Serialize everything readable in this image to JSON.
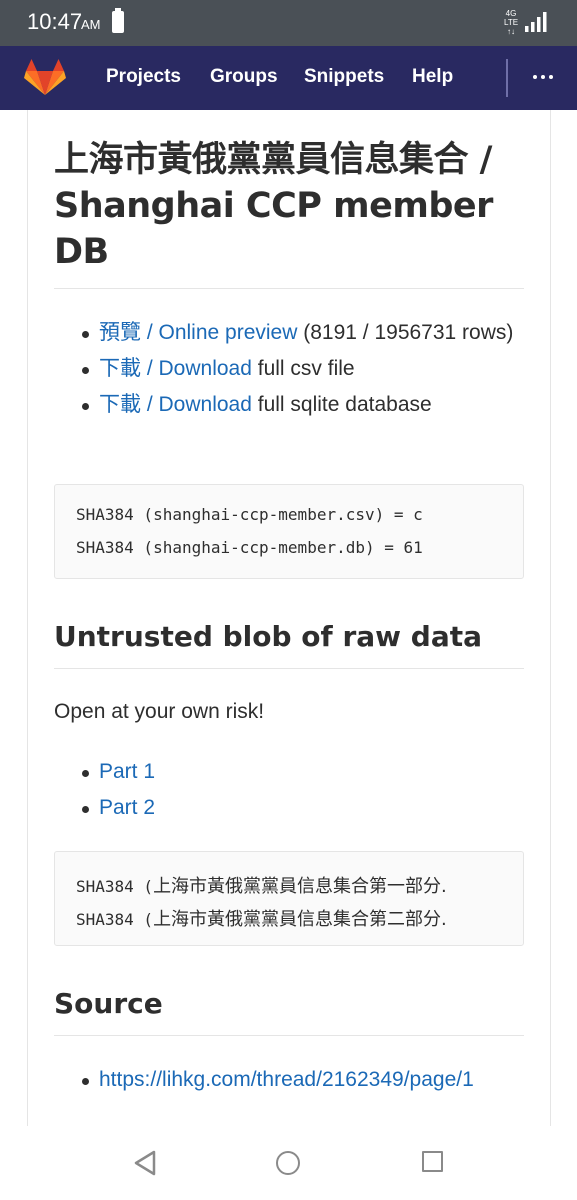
{
  "status_bar": {
    "time": "10:47",
    "ampm": "AM",
    "network": "4G LTE",
    "icons": [
      "battery-icon",
      "signal-icon"
    ]
  },
  "header": {
    "logo": "gitlab-logo",
    "nav": [
      "Projects",
      "Groups",
      "Snippets",
      "Help"
    ],
    "more_icon": "more-dots-icon"
  },
  "page": {
    "title": "上海市黃俄黨黨員信息集合 / Shanghai CCP member DB",
    "downloads": [
      {
        "link": "預覽 / Online preview",
        "suffix": " (8191 / 1956731 rows)"
      },
      {
        "link": "下載 / Download",
        "suffix": " full csv file"
      },
      {
        "link": "下載 / Download",
        "suffix": " full sqlite database"
      }
    ],
    "hashes_1": [
      "SHA384 (shanghai-ccp-member.csv) = c",
      "SHA384 (shanghai-ccp-member.db) = 61"
    ],
    "section_raw": {
      "heading": "Untrusted blob of raw data",
      "warning": "Open at your own risk!",
      "parts": [
        "Part 1",
        "Part 2"
      ],
      "hash_prefix": "SHA384 (",
      "hash_names": [
        "上海市黃俄黨黨員信息集合第一部分.",
        "上海市黃俄黨黨員信息集合第二部分."
      ]
    },
    "section_source": {
      "heading": "Source",
      "url": "https://lihkg.com/thread/2162349/page/1"
    }
  },
  "system_nav": [
    "back-icon",
    "home-icon",
    "recents-icon"
  ],
  "colors": {
    "header_bg": "#292961",
    "status_bg": "#4a5056",
    "link": "#1b69b6",
    "text": "#2e2e2e"
  }
}
